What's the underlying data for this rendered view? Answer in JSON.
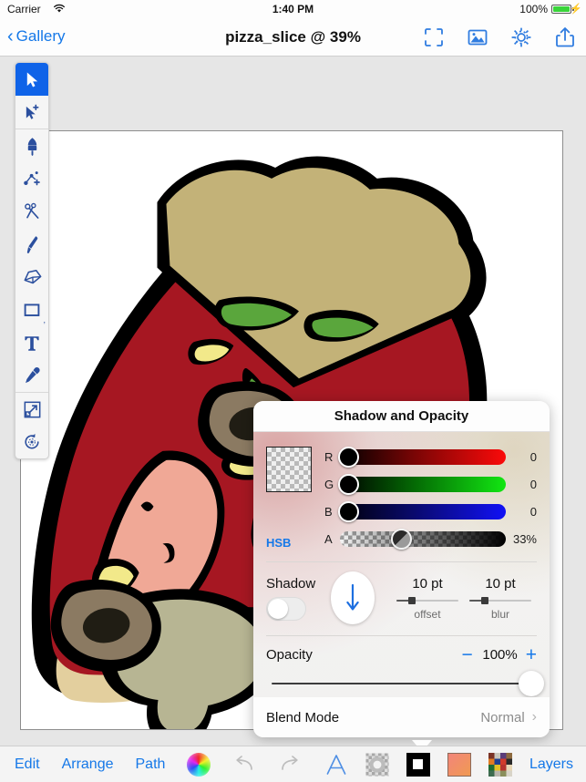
{
  "status_bar": {
    "carrier": "Carrier",
    "wifi_icon": "wifi-icon",
    "time": "1:40 PM",
    "battery_percent": "100%",
    "battery_icon": "battery-full-icon",
    "charging_icon": "lightning-bolt-icon"
  },
  "nav_bar": {
    "back_label": "Gallery",
    "back_icon": "chevron-left-icon",
    "title": "pizza_slice @ 39%",
    "actions": [
      {
        "name": "fit-to-screen-button",
        "icon": "fullscreen-frame-icon"
      },
      {
        "name": "image-button",
        "icon": "photo-icon"
      },
      {
        "name": "settings-button",
        "icon": "gear-icon"
      },
      {
        "name": "share-button",
        "icon": "share-up-arrow-icon"
      }
    ]
  },
  "tool_palette": {
    "tools": [
      {
        "name": "select-tool",
        "icon": "arrow-cursor-icon",
        "selected": true
      },
      {
        "name": "add-node-tool",
        "icon": "cursor-plus-icon",
        "selected": false
      },
      {
        "name": "pen-tool",
        "icon": "fountain-pen-nib-icon",
        "selected": false
      },
      {
        "name": "node-add-tool",
        "icon": "path-node-plus-icon",
        "selected": false
      },
      {
        "name": "scissors-tool",
        "icon": "scissors-icon",
        "selected": false
      },
      {
        "name": "brush-tool",
        "icon": "paint-brush-icon",
        "selected": false
      },
      {
        "name": "eraser-tool",
        "icon": "eraser-icon",
        "selected": false
      },
      {
        "name": "shape-tool",
        "icon": "rectangle-icon",
        "selected": false
      },
      {
        "name": "text-tool",
        "icon": "text-t-icon",
        "selected": false
      },
      {
        "name": "eyedropper-tool",
        "icon": "eyedropper-icon",
        "selected": false
      },
      {
        "name": "transform-tool",
        "icon": "scale-transform-icon",
        "selected": false
      },
      {
        "name": "rotate-tool",
        "icon": "rotate-clockwise-icon",
        "selected": false
      }
    ]
  },
  "artwork": {
    "name": "pizza-slice-illustration",
    "colors": {
      "outline": "#000000",
      "sauce": "#a61722",
      "crust_top": "#c3b278",
      "crust_bottom": "#e3cf9e",
      "pepperoni": "#f0a896",
      "pepper_green": "#5aa63c",
      "cheese_yellow": "#f2e98a",
      "mushroom": "#b7b593",
      "olive_ring": "#8b7a62",
      "olive_center": "#2e2a1e",
      "canvas": "#ffffff"
    }
  },
  "popover": {
    "title": "Shadow and Opacity",
    "color": {
      "swatch_name": "transparent-checkerboard-swatch",
      "mode_toggle_label": "HSB",
      "channels": [
        {
          "label": "R",
          "value": "0",
          "percent": 0
        },
        {
          "label": "G",
          "value": "0",
          "percent": 0
        },
        {
          "label": "B",
          "value": "0",
          "percent": 0
        },
        {
          "label": "A",
          "value": "33%",
          "percent": 33
        }
      ]
    },
    "shadow": {
      "label": "Shadow",
      "enabled": false,
      "direction_icon": "arrow-down-icon",
      "offset": {
        "value": "10 pt",
        "caption": "offset",
        "percent": 22
      },
      "blur": {
        "value": "10 pt",
        "caption": "blur",
        "percent": 22
      }
    },
    "opacity": {
      "label": "Opacity",
      "value": "100%",
      "percent": 100,
      "minus_label": "−",
      "plus_label": "+"
    },
    "blend_mode": {
      "label": "Blend Mode",
      "value": "Normal",
      "chevron_icon": "chevron-right-icon"
    },
    "accent_color": "#1578e8"
  },
  "bottom_bar": {
    "left_items": [
      {
        "name": "edit-menu-button",
        "label": "Edit"
      },
      {
        "name": "arrange-menu-button",
        "label": "Arrange"
      },
      {
        "name": "path-menu-button",
        "label": "Path"
      }
    ],
    "color_wheel_icon": "color-wheel-icon",
    "undo_icon": "undo-arrow-icon",
    "redo_icon": "redo-arrow-icon",
    "right_items": [
      {
        "name": "text-style-button",
        "icon": "outlined-a-icon"
      },
      {
        "name": "shadow-opacity-button",
        "icon": "shadow-opacity-icon",
        "active": true
      },
      {
        "name": "stroke-button",
        "icon": "black-square-stroke-icon"
      },
      {
        "name": "fill-button",
        "icon": "gradient-fill-swatch-icon"
      },
      {
        "name": "palette-button",
        "icon": "color-palette-grid-icon"
      }
    ],
    "layers_label": "Layers"
  }
}
